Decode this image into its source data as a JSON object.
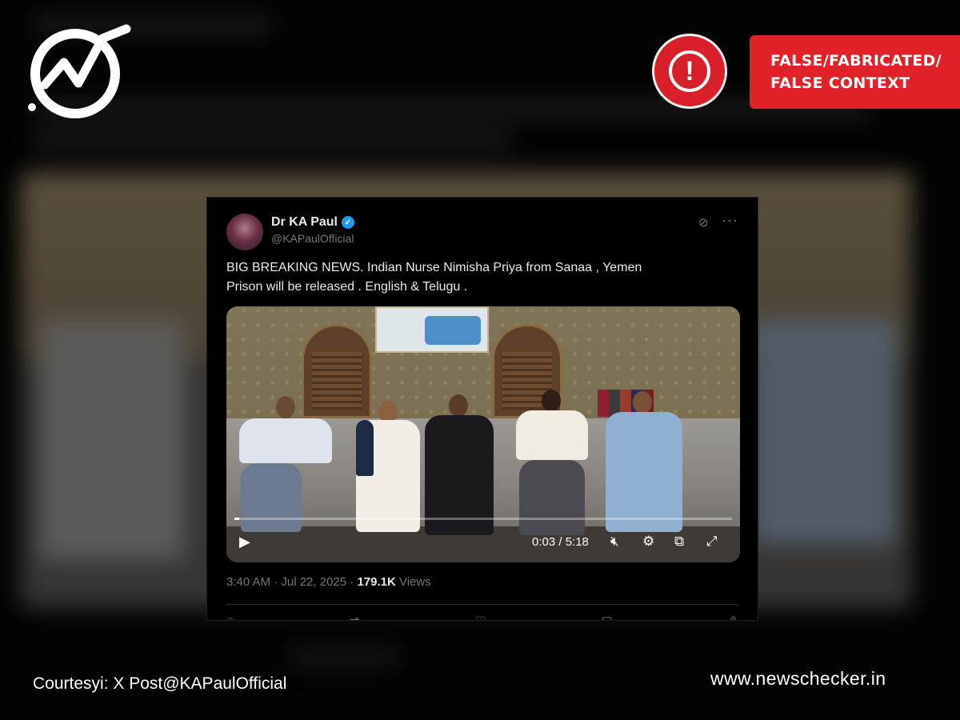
{
  "verdict": {
    "line1": "FALSE/FABRICATED/",
    "line2": "FALSE CONTEXT",
    "color": "#e02128",
    "icon": "exclamation-icon"
  },
  "logo": {
    "icon": "newschecker-check-logo"
  },
  "tweet": {
    "author": "Dr KA Paul",
    "verified_icon": "verified-badge-icon",
    "handle": "@KAPaulOfficial",
    "grok_icon": "grok-icon",
    "more_icon": "more-icon",
    "text_line1": "BIG BREAKING NEWS. Indian Nurse Nimisha Priya from Sanaa , Yemen",
    "text_line2": "Prison will be released . English & Telugu .",
    "video": {
      "time": "0:03 / 5:18",
      "progress": 0.01,
      "play_icon": "play-icon",
      "mute_icon": "mute-icon",
      "settings_icon": "settings-icon",
      "pip_icon": "picture-in-picture-icon",
      "fullscreen_icon": "fullscreen-icon"
    },
    "timestamp": "3:40 AM · Jul 22, 2025 · ",
    "views_count": "179.1K",
    "views_label": " Views"
  },
  "footer": {
    "courtesy": "Courtesyi: X Post@KAPaulOfficial",
    "site": "www.newschecker.in"
  }
}
